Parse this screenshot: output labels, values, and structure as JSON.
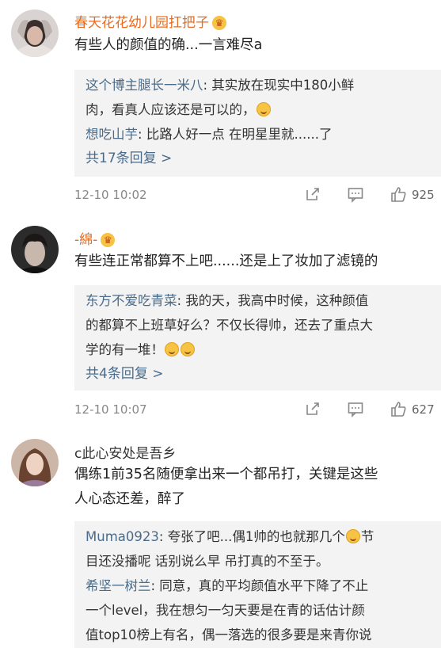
{
  "comments": [
    {
      "username": "春天花花幼儿园扛把子",
      "text": "有些人的颜值的确...一言难尽a",
      "replies": [
        {
          "name": "这个博主腿长一米八",
          "text_1": ": 其实放在现实中180小鲜",
          "text_2": "肉，看真人应该还是可以的，"
        },
        {
          "name": "想吃山芋",
          "text_1": ": 比路人好一点  在明星里就......了",
          "text_2": ""
        }
      ],
      "more": "共17条回复 >",
      "time": "12-10 10:02",
      "likes": "925"
    },
    {
      "username": "-綿-",
      "text": "有些连正常都算不上吧......还是上了妆加了滤镜的",
      "replies": [
        {
          "name": "东方不爱吃青菜",
          "text_1": ": 我的天，我高中时候，这种颜值",
          "text_2": "的都算不上班草好么？不仅长得帅，还去了重点大",
          "text_3": "学的有一堆！"
        }
      ],
      "more": "共4条回复 >",
      "time": "12-10 10:07",
      "likes": "627"
    },
    {
      "username": "c此心安处是吾乡",
      "text_1": "偶练1前35名随便拿出来一个都吊打，关键是这些",
      "text_2": "人心态还差，醉了",
      "replies": [
        {
          "name": "Muma0923",
          "text_1": ":  夸张了吧...偶1帅的也就那几个",
          "text_1b": "节",
          "text_2": "目还没播呢 话别说么早 吊打真的不至于。"
        },
        {
          "name": "希坚一树兰",
          "text_1": ": 同意，真的平均颜值水平下降了不止",
          "text_2": "一个level，我在想匀一匀天要是在青的话估计颜",
          "text_3": "值top10榜上有名，偶一落选的很多要是来青你说"
        }
      ]
    }
  ]
}
